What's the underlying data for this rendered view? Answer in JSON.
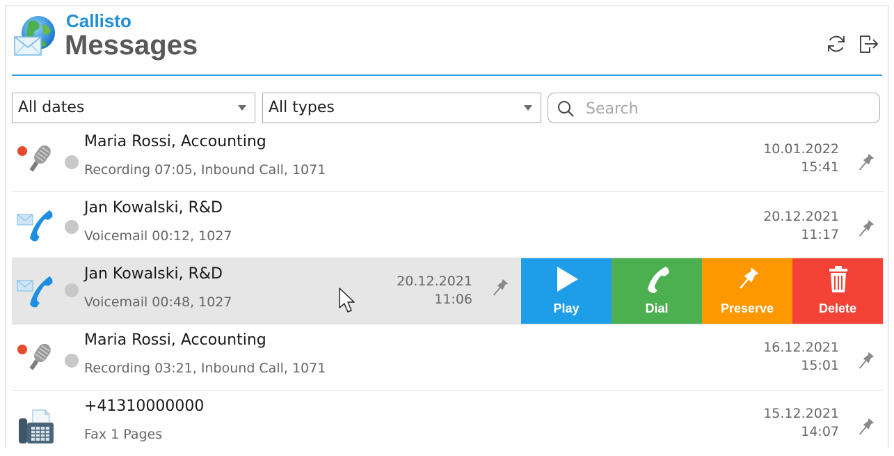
{
  "app": {
    "brand": "Callisto",
    "title": "Messages"
  },
  "header_icons": [
    "refresh-icon",
    "logout-icon"
  ],
  "filters": {
    "date_select": "All dates",
    "type_select": "All types",
    "search_placeholder": "Search"
  },
  "colors": {
    "accent": "#2fa0e0",
    "brand": "#1e8fd8",
    "play": "#1e9ee8",
    "dial": "#4caf50",
    "preserve": "#ff9800",
    "delete": "#f44336",
    "recording_dot": "#e54b2d"
  },
  "messages": [
    {
      "icon": "recording-microphone-icon",
      "name": "Maria Rossi, Accounting",
      "detail": "Recording 07:05, Inbound Call, 1071",
      "date": "10.01.2022",
      "time": "15:41"
    },
    {
      "icon": "voicemail-phone-icon",
      "name": "Jan Kowalski, R&D",
      "detail": "Voicemail 00:12, 1027",
      "date": "20.12.2021",
      "time": "11:17"
    },
    {
      "icon": "voicemail-phone-icon",
      "name": "Jan Kowalski, R&D",
      "detail": "Voicemail 00:48, 1027",
      "date": "20.12.2021",
      "time": "11:06"
    },
    {
      "icon": "recording-microphone-icon",
      "name": "Maria Rossi, Accounting",
      "detail": "Recording 03:21, Inbound Call, 1071",
      "date": "16.12.2021",
      "time": "15:01"
    },
    {
      "icon": "fax-machine-icon",
      "name": "+41310000000",
      "detail": "Fax 1 Pages",
      "date": "15.12.2021",
      "time": "14:07"
    }
  ],
  "row_actions": [
    {
      "label": "Play",
      "icon": "play-icon"
    },
    {
      "label": "Dial",
      "icon": "phone-icon"
    },
    {
      "label": "Preserve",
      "icon": "pin-icon"
    },
    {
      "label": "Delete",
      "icon": "trash-icon"
    }
  ]
}
